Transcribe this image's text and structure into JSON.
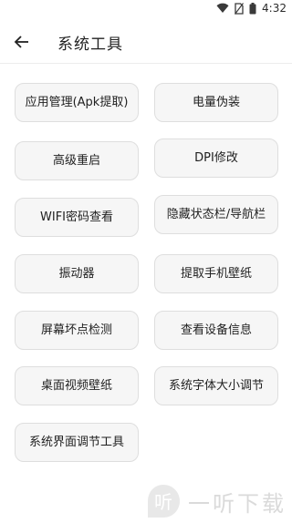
{
  "status_bar": {
    "time": "4:32"
  },
  "app_bar": {
    "title": "系统工具"
  },
  "tools": [
    {
      "label": "应用管理(Apk提取)"
    },
    {
      "label": "电量伪装"
    },
    {
      "label": "高级重启"
    },
    {
      "label": "DPI修改"
    },
    {
      "label": "WIFI密码查看"
    },
    {
      "label": "隐藏状态栏/导航栏"
    },
    {
      "label": "振动器"
    },
    {
      "label": "提取手机壁纸"
    },
    {
      "label": "屏幕坏点检测"
    },
    {
      "label": "查看设备信息"
    },
    {
      "label": "桌面视频壁纸"
    },
    {
      "label": "系统字体大小调节"
    },
    {
      "label": "系统界面调节工具"
    }
  ],
  "watermark": {
    "text": "一听下载",
    "logo_glyph": "听"
  }
}
